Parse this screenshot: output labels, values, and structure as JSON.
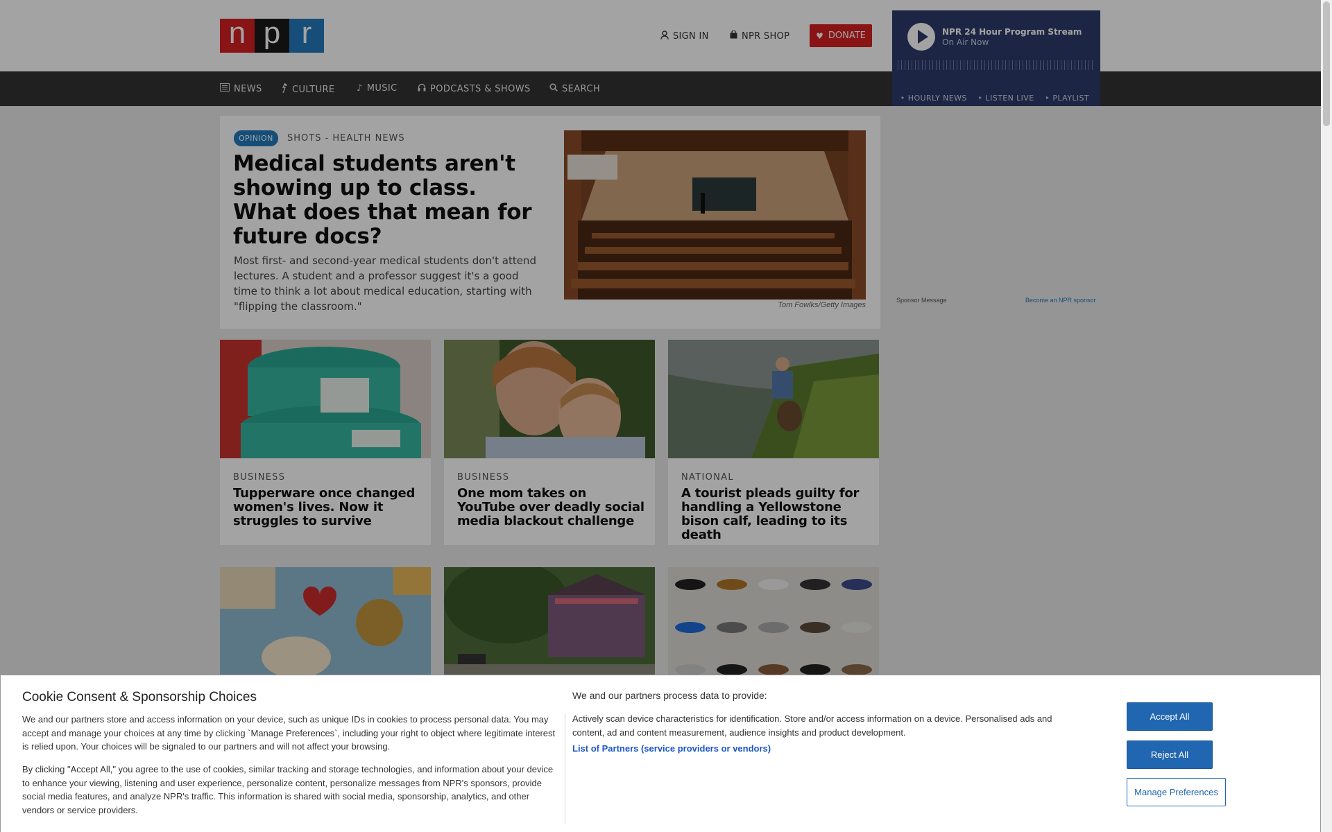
{
  "header": {
    "logo": {
      "n": "n",
      "p": "p",
      "r": "r"
    },
    "sign_in": "SIGN IN",
    "shop": "NPR SHOP",
    "donate": "DONATE"
  },
  "nav": {
    "items": [
      {
        "label": "NEWS",
        "icon": "newspaper-icon"
      },
      {
        "label": "CULTURE",
        "icon": "culture-icon"
      },
      {
        "label": "MUSIC",
        "icon": "music-note-icon"
      },
      {
        "label": "PODCASTS & SHOWS",
        "icon": "headphones-icon"
      },
      {
        "label": "SEARCH",
        "icon": "search-icon"
      }
    ]
  },
  "player": {
    "title": "NPR 24 Hour Program Stream",
    "subtitle": "On Air Now",
    "links": [
      "HOURLY NEWS",
      "LISTEN LIVE",
      "PLAYLIST"
    ]
  },
  "feature": {
    "badge": "OPINION",
    "kicker": "SHOTS - HEALTH NEWS",
    "headline": "Medical students aren't showing up to class. What does that mean for future docs?",
    "teaser": "Most first- and second-year medical students don't attend lectures. A student and a professor suggest it's a good time to think a lot about medical education, starting with \"flipping the classroom.\"",
    "credit": "Tom Fowlks/Getty Images"
  },
  "sponsor": {
    "label": "Sponsor Message",
    "link": "Become an NPR sponsor"
  },
  "cards": [
    {
      "slug": "BUSINESS",
      "title": "Tupperware once changed women's lives. Now it struggles to survive"
    },
    {
      "slug": "BUSINESS",
      "title": "One mom takes on YouTube over deadly social media blackout challenge"
    },
    {
      "slug": "NATIONAL",
      "title": "A tourist pleads guilty for handling a Yellowstone bison calf, leading to its death"
    }
  ],
  "cookie": {
    "title": "Cookie Consent & Sponsorship Choices",
    "p1": "We and our partners store and access information on your device, such as unique IDs in cookies to process personal data. You may accept and manage your choices at any time by clicking `Manage Preferences`, including your right to object where legitimate interest is relied upon. Your choices will be signaled to our partners and will not affect your browsing.",
    "p2": "By clicking \"Accept All,\" you agree to the use of cookies, similar tracking and storage technologies, and information about your device to enhance your viewing, listening and user experience, personalize content, personalize messages from NPR's sponsors, provide social media features, and analyze NPR's traffic. This information is shared with social media, sponsorship, analytics, and other vendors or service providers.",
    "right_title": "We and our partners process data to provide:",
    "right_p": "Actively scan device characteristics for identification. Store and/or access information on a device. Personalised ads and content, ad and content measurement, audience insights and product development.",
    "partners_link": "List of Partners (service providers or vendors)",
    "accept": "Accept All",
    "reject": "Reject All",
    "manage": "Manage Preferences"
  },
  "colors": {
    "npr_red": "#d62021",
    "npr_blue": "#237bbd",
    "nav_bg": "#333333",
    "player_bg": "#2e3a6b",
    "button_blue": "#2166b0"
  }
}
